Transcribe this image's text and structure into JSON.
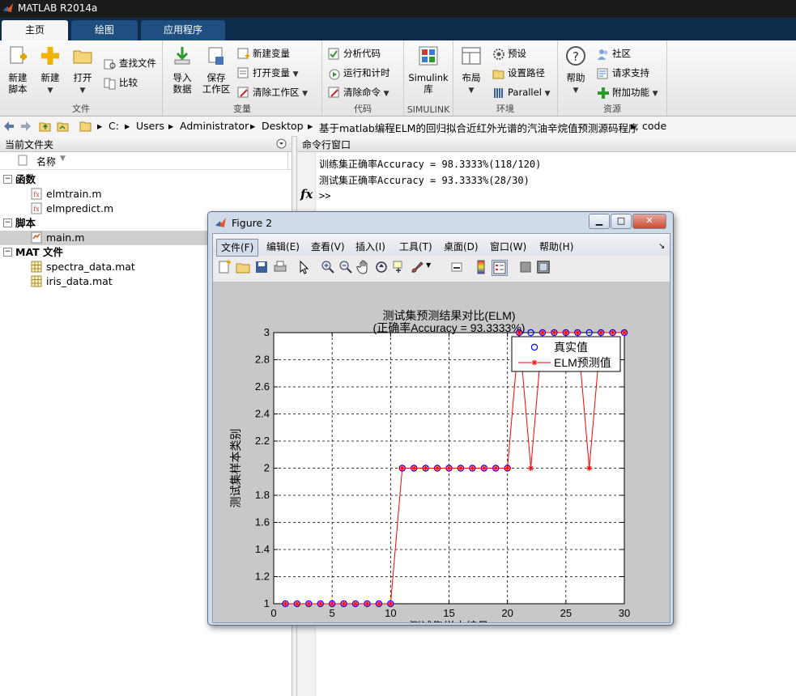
{
  "window": {
    "title": "MATLAB R2014a"
  },
  "tabs": [
    {
      "label": "主页"
    },
    {
      "label": "绘图"
    },
    {
      "label": "应用程序"
    }
  ],
  "ribbon": {
    "file": {
      "group_label": "文件",
      "new_script": "新建\n脚本",
      "new": "新建",
      "open": "打开",
      "find_files": "查找文件",
      "compare": "比较"
    },
    "variable": {
      "group_label": "变量",
      "import": "导入\n数据",
      "save_ws": "保存\n工作区",
      "new_var": "新建变量",
      "open_var": "打开变量",
      "clear_ws": "清除工作区"
    },
    "code": {
      "group_label": "代码",
      "analyze": "分析代码",
      "run_time": "运行和计时",
      "clear_cmd": "清除命令"
    },
    "simulink": {
      "group_label": "SIMULINK",
      "lib": "Simulink\n库"
    },
    "env": {
      "group_label": "环境",
      "layout": "布局",
      "prefs": "预设",
      "set_path": "设置路径",
      "parallel": "Parallel"
    },
    "resources": {
      "group_label": "资源",
      "help": "帮助",
      "community": "社区",
      "support": "请求支持",
      "addons": "附加功能"
    }
  },
  "address": {
    "path": [
      "C:",
      "Users",
      "Administrator",
      "Desktop",
      "基于matlab编程ELM的回归拟合近红外光谱的汽油辛烷值预测源码程序",
      "code"
    ]
  },
  "current_folder": {
    "title": "当前文件夹",
    "column": "名称",
    "groups": [
      {
        "label": "函数",
        "files": [
          "elmtrain.m",
          "elmpredict.m"
        ]
      },
      {
        "label": "脚本",
        "files": [
          "main.m"
        ]
      },
      {
        "label": "MAT 文件",
        "files": [
          "spectra_data.mat",
          "iris_data.mat"
        ]
      }
    ]
  },
  "command_window": {
    "title": "命令行窗口",
    "lines": [
      "训练集正确率Accuracy = 98.3333%(118/120)",
      "测试集正确率Accuracy = 93.3333%(28/30)"
    ],
    "prompt": ">>",
    "fx": "fx"
  },
  "figure": {
    "title": "Figure 2",
    "menus": [
      "文件(F)",
      "编辑(E)",
      "查看(V)",
      "插入(I)",
      "工具(T)",
      "桌面(D)",
      "窗口(W)",
      "帮助(H)"
    ]
  },
  "colors": {
    "accent_blue": "#0f2b4c",
    "true_marker": "#0000ff",
    "pred_line": "#ff0000"
  },
  "chart_data": {
    "type": "line",
    "title": "测试集预测结果对比(ELM)",
    "subtitle": "(正确率Accuracy = 93.3333%)",
    "xlabel": "测试集样本编号",
    "ylabel": "测试集样本类别",
    "xlim": [
      0,
      30
    ],
    "ylim": [
      1,
      3
    ],
    "xticks": [
      0,
      5,
      10,
      15,
      20,
      25,
      30
    ],
    "yticks": [
      1,
      1.2,
      1.4,
      1.6,
      1.8,
      2,
      2.2,
      2.4,
      2.6,
      2.8,
      3
    ],
    "grid": true,
    "legend_position": "top-right",
    "series": [
      {
        "name": "真实值",
        "marker": "o",
        "color": "#0000ff",
        "x": [
          1,
          2,
          3,
          4,
          5,
          6,
          7,
          8,
          9,
          10,
          11,
          12,
          13,
          14,
          15,
          16,
          17,
          18,
          19,
          20,
          21,
          22,
          23,
          24,
          25,
          26,
          27,
          28,
          29,
          30
        ],
        "y": [
          1,
          1,
          1,
          1,
          1,
          1,
          1,
          1,
          1,
          1,
          2,
          2,
          2,
          2,
          2,
          2,
          2,
          2,
          2,
          2,
          3,
          3,
          3,
          3,
          3,
          3,
          3,
          3,
          3,
          3
        ]
      },
      {
        "name": "ELM预测值",
        "marker": "*",
        "color": "#ff0000",
        "x": [
          1,
          2,
          3,
          4,
          5,
          6,
          7,
          8,
          9,
          10,
          11,
          12,
          13,
          14,
          15,
          16,
          17,
          18,
          19,
          20,
          21,
          22,
          23,
          24,
          25,
          26,
          27,
          28,
          29,
          30
        ],
        "y": [
          1,
          1,
          1,
          1,
          1,
          1,
          1,
          1,
          1,
          1,
          2,
          2,
          2,
          2,
          2,
          2,
          2,
          2,
          2,
          2,
          3,
          2,
          3,
          3,
          3,
          3,
          2,
          3,
          3,
          3
        ]
      }
    ]
  }
}
